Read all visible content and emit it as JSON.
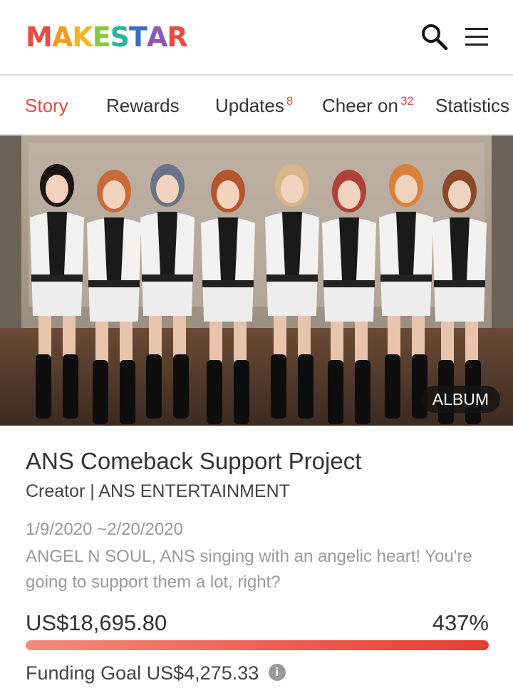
{
  "header": {
    "logo_letters": [
      "M",
      "A",
      "K",
      "E",
      "S",
      "T",
      "A",
      "R"
    ],
    "logo_colors": [
      "#e84c3d",
      "#f39a1e",
      "#f2b51b",
      "#8cc63f",
      "#2bb3a3",
      "#3a6fc4",
      "#8f58b5",
      "#e84c3d"
    ],
    "search_icon": "search-icon",
    "menu_icon": "hamburger-menu-icon"
  },
  "tabs": [
    {
      "label": "Story",
      "count": "",
      "active": true
    },
    {
      "label": "Rewards",
      "count": "",
      "active": false
    },
    {
      "label": "Updates",
      "count": "8",
      "active": false
    },
    {
      "label": "Cheer on",
      "count": "32",
      "active": false
    },
    {
      "label": "Statistics",
      "count": "",
      "active": false
    }
  ],
  "hero": {
    "badge": "ALBUM"
  },
  "project": {
    "title": "ANS Comeback Support Project",
    "creator": "Creator | ANS ENTERTAINMENT",
    "dates": "1/9/2020 ~2/20/2020",
    "description": "ANGEL N SOUL, ANS singing with an angelic heart! You're going to support them a lot, right?",
    "amount": "US$18,695.80",
    "percent": "437%",
    "progress_fraction": 1.0,
    "goal_label": "Funding Goal",
    "goal_amount": "US$4,275.33",
    "info_icon": "info-icon"
  },
  "colors": {
    "accent": "#e84c3d",
    "muted_text": "#9a9a9a"
  }
}
